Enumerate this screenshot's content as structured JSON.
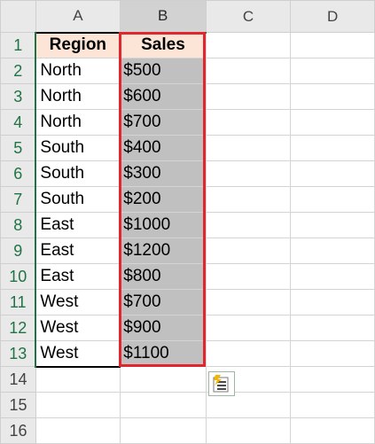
{
  "columns": [
    "A",
    "B",
    "C",
    "D"
  ],
  "rows": [
    "1",
    "2",
    "3",
    "4",
    "5",
    "6",
    "7",
    "8",
    "9",
    "10",
    "11",
    "12",
    "13",
    "14",
    "15",
    "16"
  ],
  "header": {
    "region": "Region",
    "sales": "Sales"
  },
  "data": [
    {
      "region": "North",
      "sales": "$500"
    },
    {
      "region": "North",
      "sales": "$600"
    },
    {
      "region": "North",
      "sales": "$700"
    },
    {
      "region": "South",
      "sales": "$400"
    },
    {
      "region": "South",
      "sales": "$300"
    },
    {
      "region": "South",
      "sales": "$200"
    },
    {
      "region": "East",
      "sales": "$1000"
    },
    {
      "region": "East",
      "sales": "$1200"
    },
    {
      "region": "East",
      "sales": "$800"
    },
    {
      "region": "West",
      "sales": "$700"
    },
    {
      "region": "West",
      "sales": "$900"
    },
    {
      "region": "West",
      "sales": "$1100"
    }
  ],
  "colors": {
    "header_fill": "#fce4d6",
    "selected_fill": "#c0c0c0",
    "selection_border": "#e0262e",
    "excel_green": "#217346"
  },
  "quick_analysis": {
    "icon": "quick-analysis-icon"
  }
}
